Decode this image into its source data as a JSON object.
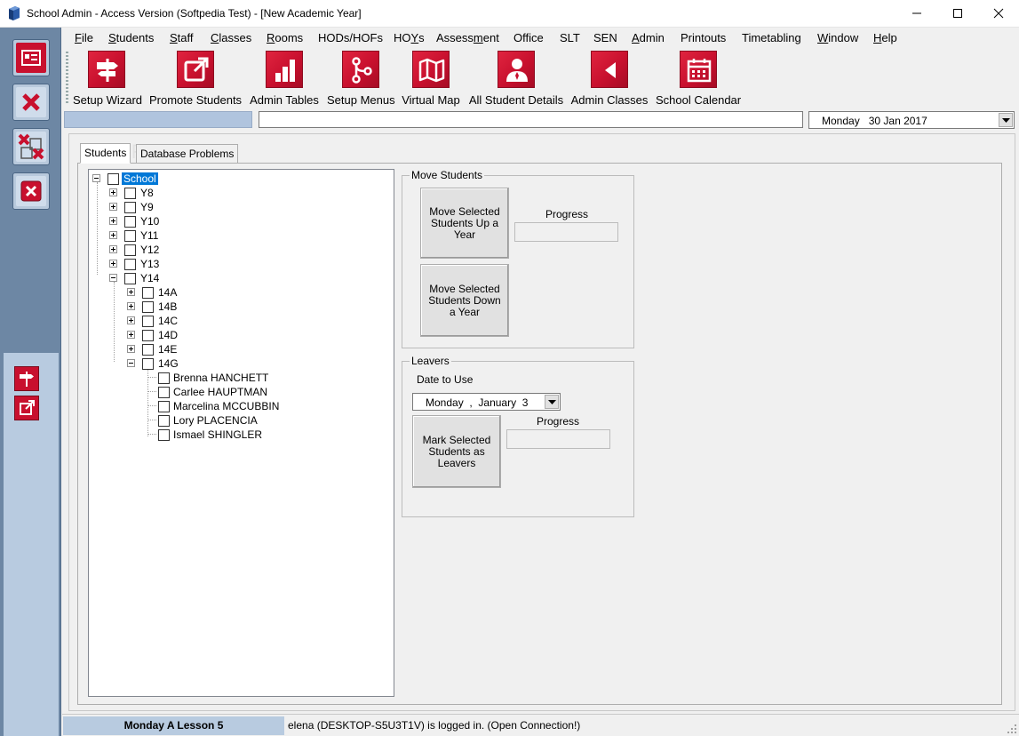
{
  "window": {
    "title": "School Admin - Access Version (Softpedia Test) - [New Academic Year]"
  },
  "menu": [
    {
      "label": "File",
      "ul": "F"
    },
    {
      "label": "Students",
      "ul": "S"
    },
    {
      "label": "Staff",
      "ul": "S"
    },
    {
      "label": "Classes",
      "ul": "C"
    },
    {
      "label": "Rooms",
      "ul": "R"
    },
    {
      "label": "HODs/HOFs",
      "ul": ""
    },
    {
      "label": "HOYs",
      "ul": "Y"
    },
    {
      "label": "Assessment",
      "ul": "m"
    },
    {
      "label": "Office",
      "ul": ""
    },
    {
      "label": "SLT",
      "ul": ""
    },
    {
      "label": "SEN",
      "ul": ""
    },
    {
      "label": "Admin",
      "ul": "A"
    },
    {
      "label": "Printouts",
      "ul": ""
    },
    {
      "label": "Timetabling",
      "ul": ""
    },
    {
      "label": "Window",
      "ul": "W"
    },
    {
      "label": "Help",
      "ul": "H"
    }
  ],
  "toolbar": [
    {
      "label": "Setup Wizard",
      "icon": "signpost-icon"
    },
    {
      "label": "Promote Students",
      "icon": "external-arrow-icon"
    },
    {
      "label": "Admin Tables",
      "icon": "bar-chart-icon"
    },
    {
      "label": "Setup Menus",
      "icon": "branch-icon"
    },
    {
      "label": "Virtual Map",
      "icon": "map-icon"
    },
    {
      "label": "All Student Details",
      "icon": "person-icon"
    },
    {
      "label": "Admin Classes",
      "icon": "triangle-left-icon"
    },
    {
      "label": "School Calendar",
      "icon": "calendar-icon"
    }
  ],
  "date_bar": {
    "day": "Monday",
    "date": "30 Jan 2017"
  },
  "tabs": [
    "Students",
    "Database Problems"
  ],
  "tree": {
    "root": "School",
    "years": [
      "Y8",
      "Y9",
      "Y10",
      "Y11",
      "Y12",
      "Y13",
      "Y14"
    ],
    "y14_groups": [
      "14A",
      "14B",
      "14C",
      "14D",
      "14E",
      "14G"
    ],
    "g14_students": [
      "Brenna HANCHETT",
      "Carlee HAUPTMAN",
      "Marcelina MCCUBBIN",
      "Lory PLACENCIA",
      "Ismael SHINGLER"
    ]
  },
  "move_students": {
    "group_label": "Move Students",
    "up_button": "Move Selected Students Up a Year",
    "down_button": "Move Selected Students Down a Year",
    "progress_label": "Progress"
  },
  "leavers": {
    "group_label": "Leavers",
    "date_label": "Date to Use",
    "date_day": "Monday",
    "date_sep": ",",
    "date_month": "January",
    "date_trail": "3",
    "button": "Mark Selected Students as Leavers",
    "progress_label": "Progress"
  },
  "status": {
    "lesson": "Monday A Lesson 5",
    "message": "elena (DESKTOP-S5U3T1V) is logged in. (Open Connection!)"
  },
  "colors": {
    "accent_red": "#c8102e",
    "sidebar_blue": "#6d87a4",
    "selection": "#0078d7"
  }
}
